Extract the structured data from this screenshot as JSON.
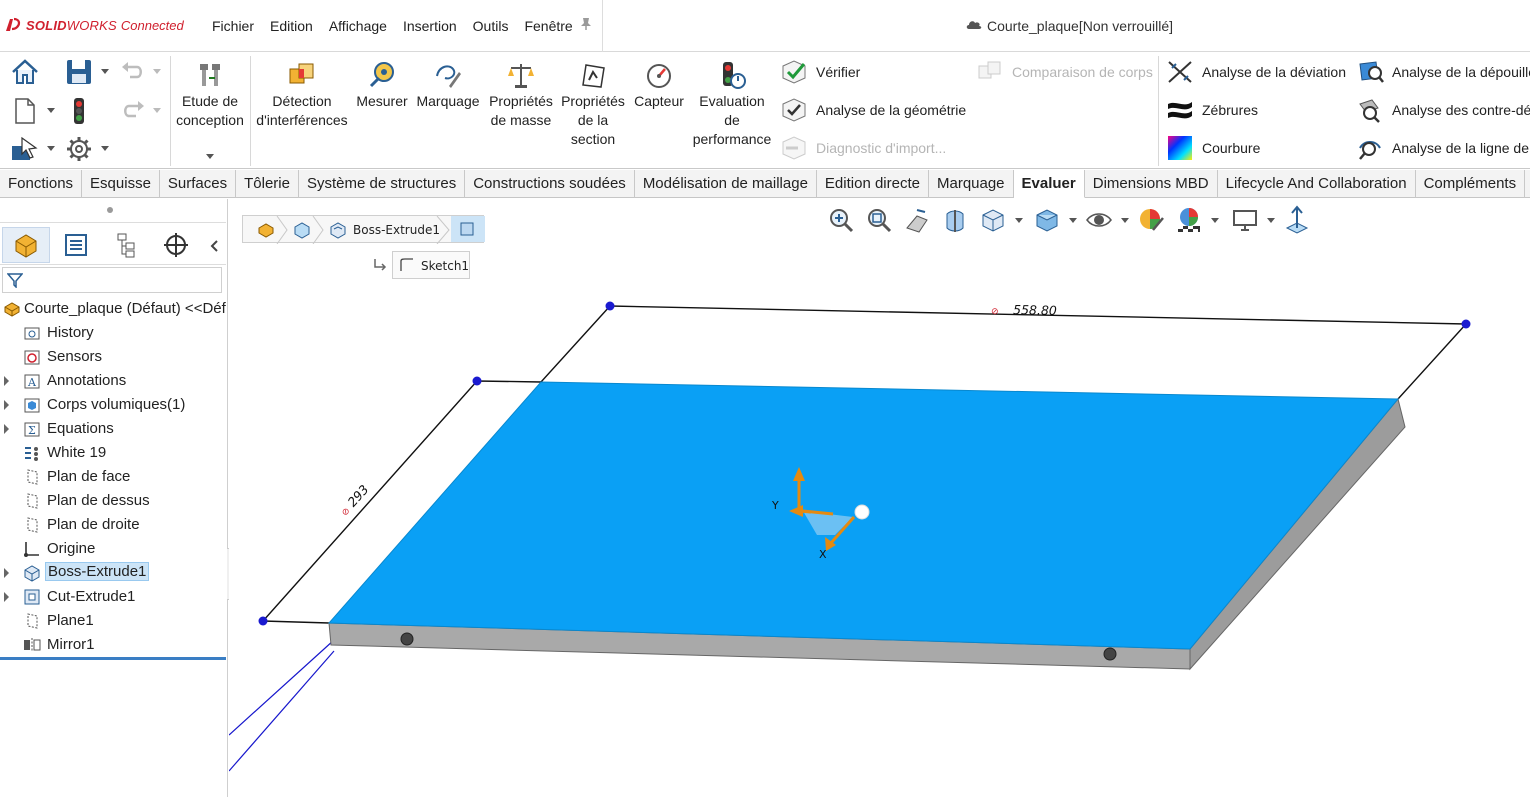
{
  "app": {
    "brand_prefix": "SOLID",
    "brand_main": "WORKS",
    "brand_suffix": "Connected",
    "brand_color": "#d0202e"
  },
  "menu": {
    "items": [
      "Fichier",
      "Edition",
      "Affichage",
      "Insertion",
      "Outils",
      "Fenêtre"
    ]
  },
  "document": {
    "title": "Courte_plaque[Non verrouillé]"
  },
  "ribbon": {
    "etude_conception": "Etude de conception",
    "detection_interferences": "Détection d'interférences",
    "mesurer": "Mesurer",
    "marquage": "Marquage",
    "proprietes_masse": "Propriétés de masse",
    "proprietes_section": "Propriétés de la section",
    "capteur": "Capteur",
    "evaluation_performance": "Evaluation de performance",
    "verifier": "Vérifier",
    "analyse_geometrie": "Analyse de la géométrie",
    "diagnostic_import": "Diagnostic d'import...",
    "comparaison_corps": "Comparaison de corps",
    "analyse_deviation": "Analyse de la déviation",
    "zebrures": "Zébrures",
    "courbure": "Courbure",
    "analyse_depouille": "Analyse de la dépouille",
    "analyse_contre_depouille": "Analyse des contre-dépouilles",
    "analyse_ligne_joint": "Analyse de la ligne de joint"
  },
  "tabs": [
    {
      "label": "Fonctions",
      "active": false
    },
    {
      "label": "Esquisse",
      "active": false
    },
    {
      "label": "Surfaces",
      "active": false
    },
    {
      "label": "Tôlerie",
      "active": false
    },
    {
      "label": "Système de structures",
      "active": false
    },
    {
      "label": "Constructions soudées",
      "active": false
    },
    {
      "label": "Modélisation de maillage",
      "active": false
    },
    {
      "label": "Edition directe",
      "active": false
    },
    {
      "label": "Marquage",
      "active": false
    },
    {
      "label": "Evaluer",
      "active": true
    },
    {
      "label": "Dimensions MBD",
      "active": false
    },
    {
      "label": "Lifecycle And Collaboration",
      "active": false
    },
    {
      "label": "Compléments",
      "active": false
    }
  ],
  "tree": {
    "root": "Courte_plaque (Défaut) <<Défaut>",
    "items": [
      {
        "label": "History",
        "icon": "history-folder-icon",
        "expandable": false,
        "selected": false
      },
      {
        "label": "Sensors",
        "icon": "sensors-icon",
        "expandable": false,
        "selected": false
      },
      {
        "label": "Annotations",
        "icon": "annotations-icon",
        "expandable": true,
        "selected": false
      },
      {
        "label": "Corps volumiques(1)",
        "icon": "solid-bodies-icon",
        "expandable": true,
        "selected": false
      },
      {
        "label": "Equations",
        "icon": "equations-icon",
        "expandable": true,
        "selected": false
      },
      {
        "label": "White 19",
        "icon": "material-icon",
        "expandable": false,
        "selected": false
      },
      {
        "label": "Plan de face",
        "icon": "plane-icon",
        "expandable": false,
        "selected": false
      },
      {
        "label": "Plan de dessus",
        "icon": "plane-icon",
        "expandable": false,
        "selected": false
      },
      {
        "label": "Plan de droite",
        "icon": "plane-icon",
        "expandable": false,
        "selected": false
      },
      {
        "label": "Origine",
        "icon": "origin-icon",
        "expandable": false,
        "selected": false
      },
      {
        "label": "Boss-Extrude1",
        "icon": "boss-extrude-icon",
        "expandable": true,
        "selected": true
      },
      {
        "label": "Cut-Extrude1",
        "icon": "cut-extrude-icon",
        "expandable": true,
        "selected": false
      },
      {
        "label": "Plane1",
        "icon": "plane-icon",
        "expandable": false,
        "selected": false
      },
      {
        "label": "Mirror1",
        "icon": "mirror-icon",
        "expandable": false,
        "selected": false
      }
    ]
  },
  "breadcrumb": {
    "feature": "Boss-Extrude1",
    "sketch": "Sketch1"
  },
  "model": {
    "dimension_length": "558.80",
    "dimension_width": "293",
    "triad_y": "Y",
    "triad_x": "X",
    "face_color": "#0aa0f5",
    "side_color": "#a8a8a8"
  }
}
